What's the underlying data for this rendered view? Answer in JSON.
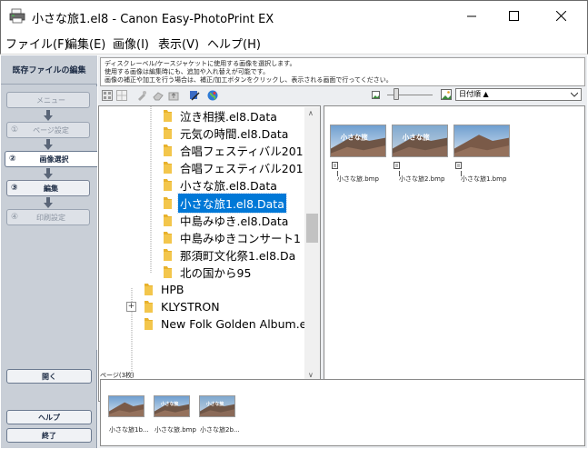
{
  "window": {
    "title": "小さな旅1.el8 - Canon Easy-PhotoPrint EX",
    "minimize_glyph": "—",
    "maximize_glyph": "☐",
    "close_glyph": "✕"
  },
  "menu": [
    {
      "label": "ファイル(F)"
    },
    {
      "label": "編集(E)"
    },
    {
      "label": "画像(I)"
    },
    {
      "label": "表示(V)"
    },
    {
      "label": "ヘルプ(H)"
    }
  ],
  "sidebar": {
    "header": "既存ファイルの編集",
    "steps": [
      {
        "num": "",
        "label": "メニュー",
        "state": "disabled"
      },
      {
        "num": "①",
        "label": "ページ設定",
        "state": "disabled"
      },
      {
        "num": "②",
        "label": "画像選択",
        "state": "current"
      },
      {
        "num": "③",
        "label": "編集",
        "state": "enabled"
      },
      {
        "num": "④",
        "label": "印刷設定",
        "state": "disabled"
      }
    ],
    "open_button": "開く",
    "help_button": "ヘルプ",
    "exit_button": "終了"
  },
  "instructions": {
    "line1": "ディスクレーベル/ケースジャケットに使用する画像を選択します。",
    "line2": "使用する画像は編集時にも、追加や入れ替えが可能です。",
    "line3": "画像の補正や加工を行う場合は、補正/加工ボタンをクリックし、表示される画面で行ってください。"
  },
  "toolbar": {
    "icons": [
      "view-details-icon",
      "view-thumbnails-icon",
      "tool-icon",
      "eraser-icon",
      "folder-up-icon",
      "media-icon",
      "globe-icon"
    ]
  },
  "zoom": {
    "level": 0.2
  },
  "sort": {
    "selected": "日付順 ▲"
  },
  "tree": {
    "items": [
      {
        "label": "泣き相撲.el8.Data",
        "level": 2,
        "selected": false
      },
      {
        "label": "元気の時間.el8.Data",
        "level": 2,
        "selected": false
      },
      {
        "label": "合唱フェスティバル201",
        "level": 2,
        "selected": false
      },
      {
        "label": "合唱フェスティバル201",
        "level": 2,
        "selected": false
      },
      {
        "label": "小さな旅.el8.Data",
        "level": 2,
        "selected": false
      },
      {
        "label": "小さな旅1.el8.Data",
        "level": 2,
        "selected": true
      },
      {
        "label": "中島みゆき.el8.Data",
        "level": 2,
        "selected": false
      },
      {
        "label": "中島みゆきコンサート1",
        "level": 2,
        "selected": false
      },
      {
        "label": "那須町文化祭1.el8.Da",
        "level": 2,
        "selected": false
      },
      {
        "label": "北の国から95",
        "level": 2,
        "selected": false
      },
      {
        "label": "HPB",
        "level": 1,
        "selected": false,
        "expander": ""
      },
      {
        "label": "KLYSTRON",
        "level": 1,
        "selected": false,
        "expander": "+"
      },
      {
        "label": "New Folk Golden Album.el",
        "level": 1,
        "selected": false,
        "expander": ""
      }
    ]
  },
  "thumbnails": [
    {
      "label": "小さな旅.bmp",
      "caption": "小さな旅",
      "style": "a"
    },
    {
      "label": "小さな旅2.bmp",
      "caption": "小さな旅",
      "style": "b"
    },
    {
      "label": "小さな旅1.bmp",
      "caption": "",
      "style": "c"
    }
  ],
  "pages": {
    "label": "ページ(3枚)",
    "items": [
      {
        "label": "小さな旅1b..."
      },
      {
        "label": "小さな旅.bmp"
      },
      {
        "label": "小さな旅2b..."
      }
    ]
  },
  "colors": {
    "selection": "#0078d7",
    "sidebar_bg": "#c9cfd7",
    "folder": "#e8b22c"
  }
}
